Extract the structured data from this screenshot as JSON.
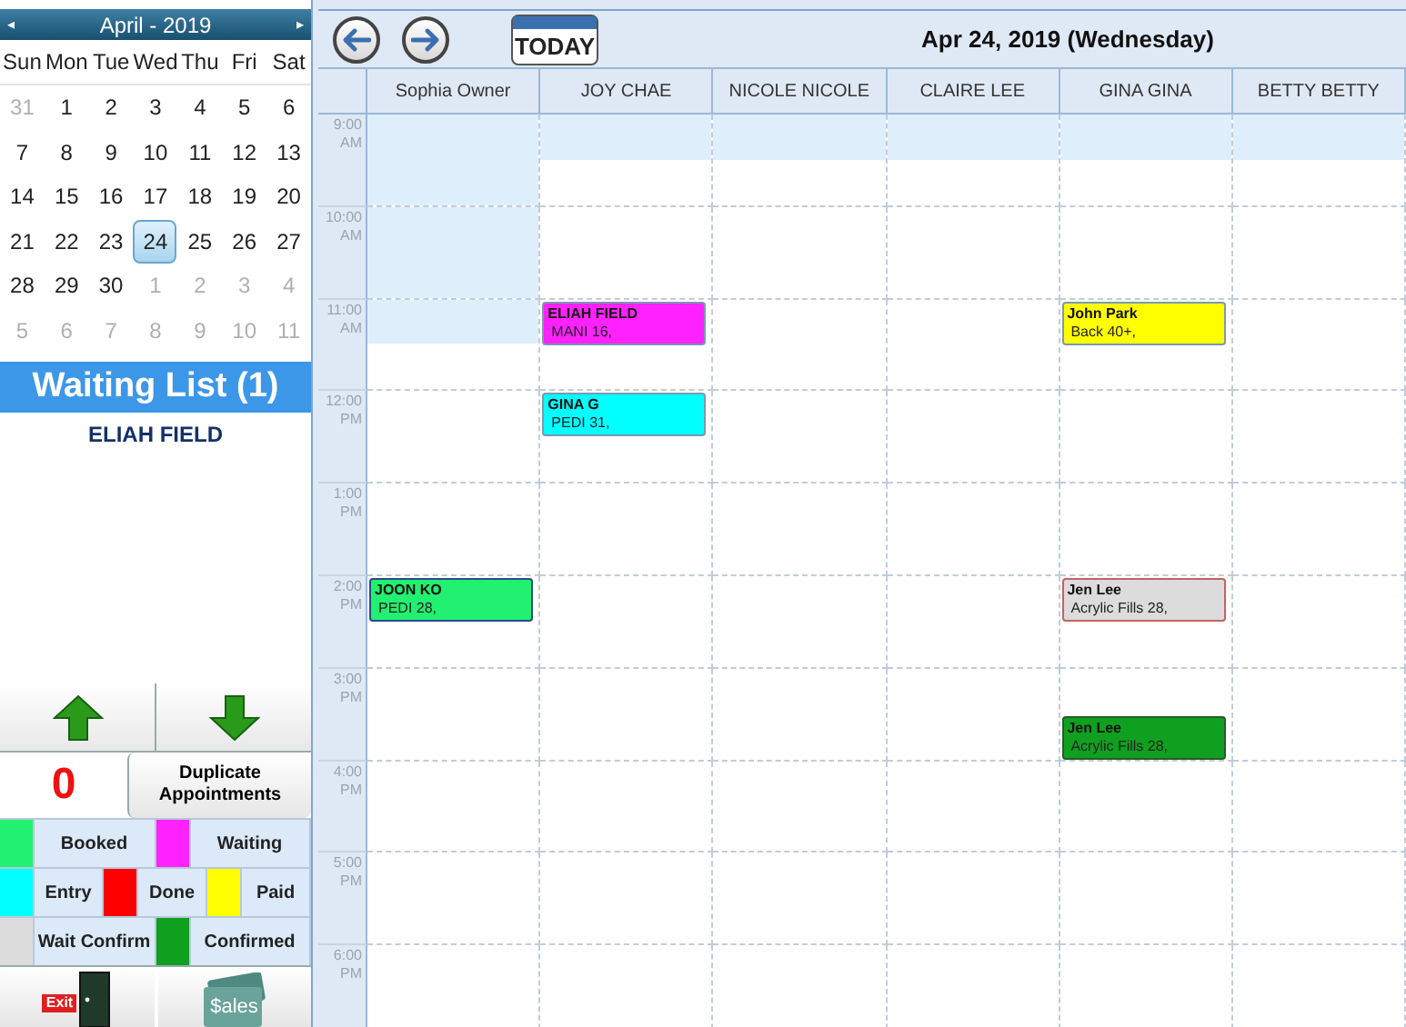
{
  "calendar": {
    "title": "April - 2019",
    "prev": "◂",
    "next": "▸",
    "weekdays": [
      "Sun",
      "Mon",
      "Tue",
      "Wed",
      "Thu",
      "Fri",
      "Sat"
    ],
    "weeks": [
      [
        {
          "label": "31",
          "other_month": true,
          "selected": false
        },
        {
          "label": "1",
          "other_month": false,
          "selected": false
        },
        {
          "label": "2",
          "other_month": false,
          "selected": false
        },
        {
          "label": "3",
          "other_month": false,
          "selected": false
        },
        {
          "label": "4",
          "other_month": false,
          "selected": false
        },
        {
          "label": "5",
          "other_month": false,
          "selected": false
        },
        {
          "label": "6",
          "other_month": false,
          "selected": false
        }
      ],
      [
        {
          "label": "7",
          "other_month": false,
          "selected": false
        },
        {
          "label": "8",
          "other_month": false,
          "selected": false
        },
        {
          "label": "9",
          "other_month": false,
          "selected": false
        },
        {
          "label": "10",
          "other_month": false,
          "selected": false
        },
        {
          "label": "11",
          "other_month": false,
          "selected": false
        },
        {
          "label": "12",
          "other_month": false,
          "selected": false
        },
        {
          "label": "13",
          "other_month": false,
          "selected": false
        }
      ],
      [
        {
          "label": "14",
          "other_month": false,
          "selected": false
        },
        {
          "label": "15",
          "other_month": false,
          "selected": false
        },
        {
          "label": "16",
          "other_month": false,
          "selected": false
        },
        {
          "label": "17",
          "other_month": false,
          "selected": false
        },
        {
          "label": "18",
          "other_month": false,
          "selected": false
        },
        {
          "label": "19",
          "other_month": false,
          "selected": false
        },
        {
          "label": "20",
          "other_month": false,
          "selected": false
        }
      ],
      [
        {
          "label": "21",
          "other_month": false,
          "selected": false
        },
        {
          "label": "22",
          "other_month": false,
          "selected": false
        },
        {
          "label": "23",
          "other_month": false,
          "selected": false
        },
        {
          "label": "24",
          "other_month": false,
          "selected": true
        },
        {
          "label": "25",
          "other_month": false,
          "selected": false
        },
        {
          "label": "26",
          "other_month": false,
          "selected": false
        },
        {
          "label": "27",
          "other_month": false,
          "selected": false
        }
      ],
      [
        {
          "label": "28",
          "other_month": false,
          "selected": false
        },
        {
          "label": "29",
          "other_month": false,
          "selected": false
        },
        {
          "label": "30",
          "other_month": false,
          "selected": false
        },
        {
          "label": "1",
          "other_month": true,
          "selected": false
        },
        {
          "label": "2",
          "other_month": true,
          "selected": false
        },
        {
          "label": "3",
          "other_month": true,
          "selected": false
        },
        {
          "label": "4",
          "other_month": true,
          "selected": false
        }
      ],
      [
        {
          "label": "5",
          "other_month": true,
          "selected": false
        },
        {
          "label": "6",
          "other_month": true,
          "selected": false
        },
        {
          "label": "7",
          "other_month": true,
          "selected": false
        },
        {
          "label": "8",
          "other_month": true,
          "selected": false
        },
        {
          "label": "9",
          "other_month": true,
          "selected": false
        },
        {
          "label": "10",
          "other_month": true,
          "selected": false
        },
        {
          "label": "11",
          "other_month": true,
          "selected": false
        }
      ]
    ]
  },
  "waiting_list": {
    "title": "Waiting List (1)",
    "items": [
      "ELIAH FIELD"
    ]
  },
  "duplicate_count": "0",
  "duplicate_button": "Duplicate Appointments",
  "legend": [
    [
      {
        "kind": "booked",
        "label": "Booked",
        "color": "#22f070"
      },
      {
        "kind": "waiting",
        "label": "Waiting",
        "color": "#ff22ff"
      }
    ],
    [
      {
        "kind": "entry",
        "label": "Entry",
        "color": "#00ffff"
      },
      {
        "kind": "done",
        "label": "Done",
        "color": "#ff0000"
      },
      {
        "kind": "paid",
        "label": "Paid",
        "color": "#ffff00"
      }
    ],
    [
      {
        "kind": "wait_confirm",
        "label": "Wait Confirm",
        "color": "#dcdcdc"
      },
      {
        "kind": "confirmed",
        "label": "Confirmed",
        "color": "#10a020"
      }
    ]
  ],
  "sales_label": "$ales",
  "exit_label": "Exit",
  "toolbar": {
    "today": "TODAY",
    "date": "Apr 24, 2019 (Wednesday)"
  },
  "columns": [
    "Sophia Owner",
    "JOY CHAE",
    "NICOLE NICOLE",
    "CLAIRE LEE",
    "GINA GINA",
    "BETTY BETTY"
  ],
  "hours": [
    {
      "label": "9:00 AM",
      "cells": [
        {
          "shaded_top": true,
          "shaded_bottom": true
        },
        {
          "shaded_top": true,
          "shaded_bottom": false
        },
        {
          "shaded_top": true,
          "shaded_bottom": false
        },
        {
          "shaded_top": true,
          "shaded_bottom": false
        },
        {
          "shaded_top": true,
          "shaded_bottom": false
        },
        {
          "shaded_top": true,
          "shaded_bottom": false
        }
      ]
    },
    {
      "label": "10:00 AM",
      "cells": [
        {
          "shaded_top": true,
          "shaded_bottom": true
        },
        {
          "shaded_top": false,
          "shaded_bottom": false
        },
        {
          "shaded_top": false,
          "shaded_bottom": false
        },
        {
          "shaded_top": false,
          "shaded_bottom": false
        },
        {
          "shaded_top": false,
          "shaded_bottom": false
        },
        {
          "shaded_top": false,
          "shaded_bottom": false
        }
      ]
    },
    {
      "label": "11:00 AM",
      "cells": [
        {
          "shaded_top": true,
          "shaded_bottom": false
        },
        {
          "shaded_top": false,
          "shaded_bottom": false,
          "appointments": [
            {
              "client": "ELIAH FIELD",
              "service": "MANI 16,",
              "kind": "waiting",
              "lower_half": false
            }
          ]
        },
        {
          "shaded_top": false,
          "shaded_bottom": false
        },
        {
          "shaded_top": false,
          "shaded_bottom": false
        },
        {
          "shaded_top": false,
          "shaded_bottom": false,
          "appointments": [
            {
              "client": "John Park",
              "service": "Back 40+,",
              "kind": "paid",
              "lower_half": false
            }
          ]
        },
        {
          "shaded_top": false,
          "shaded_bottom": false
        }
      ]
    },
    {
      "label": "12:00 PM",
      "cells": [
        {
          "shaded_top": false,
          "shaded_bottom": false
        },
        {
          "shaded_top": false,
          "shaded_bottom": false,
          "appointments": [
            {
              "client": "GINA G",
              "service": "PEDI 31,",
              "kind": "entry",
              "lower_half": false
            }
          ]
        },
        {
          "shaded_top": false,
          "shaded_bottom": false
        },
        {
          "shaded_top": false,
          "shaded_bottom": false
        },
        {
          "shaded_top": false,
          "shaded_bottom": false
        },
        {
          "shaded_top": false,
          "shaded_bottom": false
        }
      ]
    },
    {
      "label": "1:00 PM",
      "cells": [
        {
          "shaded_top": false,
          "shaded_bottom": false
        },
        {
          "shaded_top": false,
          "shaded_bottom": false
        },
        {
          "shaded_top": false,
          "shaded_bottom": false
        },
        {
          "shaded_top": false,
          "shaded_bottom": false
        },
        {
          "shaded_top": false,
          "shaded_bottom": false
        },
        {
          "shaded_top": false,
          "shaded_bottom": false
        }
      ]
    },
    {
      "label": "2:00 PM",
      "cells": [
        {
          "shaded_top": false,
          "shaded_bottom": false,
          "appointments": [
            {
              "client": "JOON KO",
              "service": "PEDI 28,",
              "kind": "booked",
              "lower_half": false
            }
          ]
        },
        {
          "shaded_top": false,
          "shaded_bottom": false
        },
        {
          "shaded_top": false,
          "shaded_bottom": false
        },
        {
          "shaded_top": false,
          "shaded_bottom": false
        },
        {
          "shaded_top": false,
          "shaded_bottom": false,
          "appointments": [
            {
              "client": "Jen Lee",
              "service": "Acrylic Fills 28,",
              "kind": "wait_confirm",
              "lower_half": false
            }
          ]
        },
        {
          "shaded_top": false,
          "shaded_bottom": false
        }
      ]
    },
    {
      "label": "3:00 PM",
      "cells": [
        {
          "shaded_top": false,
          "shaded_bottom": false
        },
        {
          "shaded_top": false,
          "shaded_bottom": false
        },
        {
          "shaded_top": false,
          "shaded_bottom": false
        },
        {
          "shaded_top": false,
          "shaded_bottom": false
        },
        {
          "shaded_top": false,
          "shaded_bottom": false,
          "appointments": [
            {
              "client": "Jen Lee",
              "service": "Acrylic Fills 28,",
              "kind": "confirmed",
              "lower_half": true
            }
          ]
        },
        {
          "shaded_top": false,
          "shaded_bottom": false
        }
      ]
    },
    {
      "label": "4:00 PM",
      "cells": [
        {
          "shaded_top": false,
          "shaded_bottom": false
        },
        {
          "shaded_top": false,
          "shaded_bottom": false
        },
        {
          "shaded_top": false,
          "shaded_bottom": false
        },
        {
          "shaded_top": false,
          "shaded_bottom": false
        },
        {
          "shaded_top": false,
          "shaded_bottom": false
        },
        {
          "shaded_top": false,
          "shaded_bottom": false
        }
      ]
    },
    {
      "label": "5:00 PM",
      "cells": [
        {
          "shaded_top": false,
          "shaded_bottom": false
        },
        {
          "shaded_top": false,
          "shaded_bottom": false
        },
        {
          "shaded_top": false,
          "shaded_bottom": false
        },
        {
          "shaded_top": false,
          "shaded_bottom": false
        },
        {
          "shaded_top": false,
          "shaded_bottom": false
        },
        {
          "shaded_top": false,
          "shaded_bottom": false
        }
      ]
    },
    {
      "label": "6:00 PM",
      "cells": [
        {
          "shaded_top": false,
          "shaded_bottom": false
        },
        {
          "shaded_top": false,
          "shaded_bottom": false
        },
        {
          "shaded_top": false,
          "shaded_bottom": false
        },
        {
          "shaded_top": false,
          "shaded_bottom": false
        },
        {
          "shaded_top": false,
          "shaded_bottom": false
        },
        {
          "shaded_top": false,
          "shaded_bottom": false
        }
      ]
    }
  ]
}
